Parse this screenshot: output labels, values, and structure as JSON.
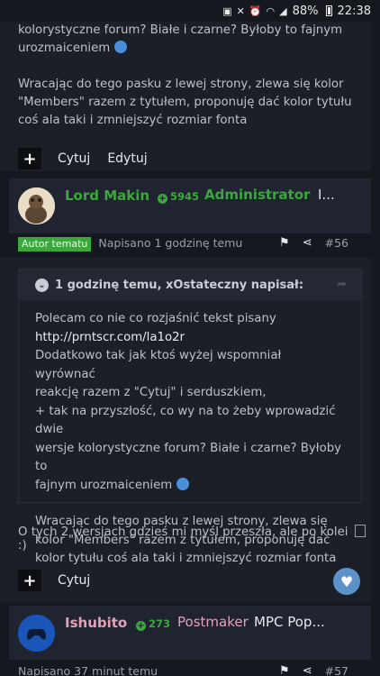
{
  "status_bar": {
    "battery": "88%",
    "time": "22:38"
  },
  "post1": {
    "text_lines": [
      "kolorystyczne forum? Białe i czarne? Byłoby to fajnym",
      "urozmaiceniem"
    ],
    "paragraph2": "Wracając do tego pasku z lewej strony, zlewa się kolor \"Members\" razem z tytułem, proponuję dać kolor tytułu coś ala taki i zmniejszyć rozmiar fonta",
    "actions": {
      "plus": "+",
      "quote": "Cytuj",
      "edit": "Edytuj"
    }
  },
  "post2_header": {
    "author": "Lord Makin",
    "reputation": "5945",
    "role": "Administrator",
    "role_tail": "I..."
  },
  "post2_meta": {
    "badge": "Autor tematu",
    "posted": "Napisano 1 godzinę temu",
    "number": "#56"
  },
  "post2": {
    "quote_header": "1 godzinę temu, xOstateczny napisał:",
    "quote_lines": [
      "Polecam co nie co rozjaśnić tekst pisany",
      "http://prntscr.com/la1o2r",
      "Dodatkowo tak jak ktoś wyżej wspomniał wyrównać",
      "reakcję razem z \"Cytuj\" i serduszkiem,",
      "+ tak na przyszłość, co wy na to żeby wprowadzić dwie",
      "wersje kolorystyczne forum? Białe i czarne? Byłoby to",
      "fajnym urozmaiceniem"
    ],
    "quote_paragraph2": "Wracając do tego pasku z lewej strony, zlewa się kolor \"Members\" razem z tytułem, proponuję dać kolor tytułu coś ala taki i zmniejszyć rozmiar fonta",
    "after_text": "O tych 2 wersjach gdzieś mi myśl przeszła, ale po kolei",
    "after_emoticon_alt": ":)",
    "actions": {
      "plus": "+",
      "quote": "Cytuj"
    }
  },
  "post3_header": {
    "author": "Ishubito",
    "reputation": "273",
    "role": "Postmaker",
    "role_tail": "MPC Pop..."
  },
  "post3_meta": {
    "posted": "Napisano 37 minut temu",
    "number": "#57"
  },
  "colors": {
    "background": "#15181f",
    "post_bg": "#1b1f27",
    "header_bg": "#1f2430",
    "admin_green": "#3aa83a",
    "postmaker_pink": "#e3a0b9",
    "like_blue": "#5c92c9"
  }
}
